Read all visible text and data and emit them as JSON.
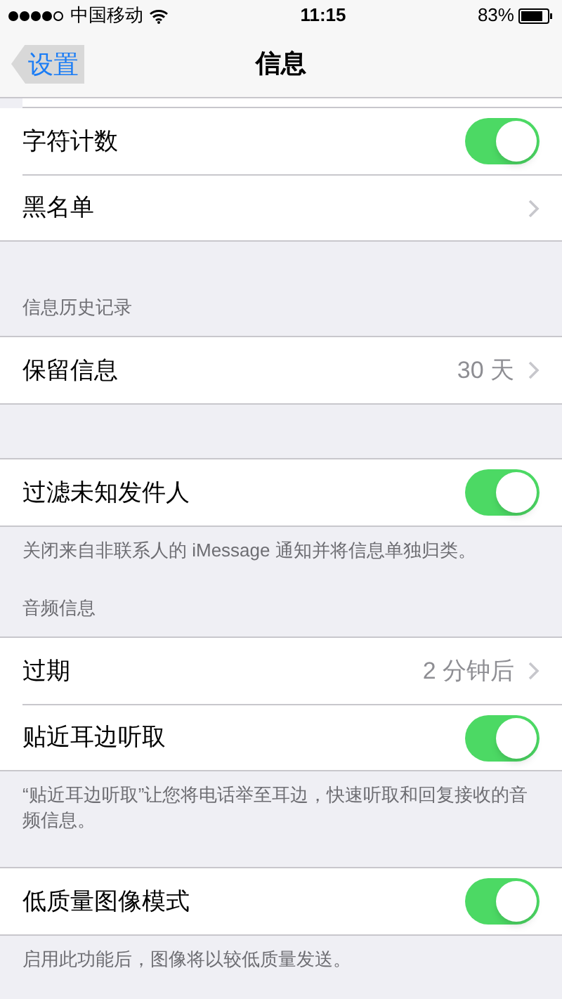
{
  "status_bar": {
    "carrier": "中国移动",
    "time": "11:15",
    "battery": "83%"
  },
  "nav": {
    "back": "设置",
    "title": "信息"
  },
  "sections": [
    {
      "items": [
        {
          "kind": "toggle",
          "label": "字符计数",
          "on": true
        },
        {
          "kind": "link",
          "label": "黑名单"
        }
      ]
    },
    {
      "header": "信息历史记录",
      "items": [
        {
          "kind": "link",
          "label": "保留信息",
          "value": "30 天"
        }
      ]
    },
    {
      "items": [
        {
          "kind": "toggle",
          "label": "过滤未知发件人",
          "on": true
        }
      ],
      "footer": "关闭来自非联系人的 iMessage 通知并将信息单独归类。"
    },
    {
      "header": "音频信息",
      "items": [
        {
          "kind": "link",
          "label": "过期",
          "value": "2 分钟后"
        },
        {
          "kind": "toggle",
          "label": "贴近耳边听取",
          "on": true
        }
      ],
      "footer": "“贴近耳边听取”让您将电话举至耳边，快速听取和回复接收的音频信息。"
    },
    {
      "items": [
        {
          "kind": "toggle",
          "label": "低质量图像模式",
          "on": true
        }
      ],
      "footer": "启用此功能后，图像将以较低质量发送。"
    }
  ]
}
